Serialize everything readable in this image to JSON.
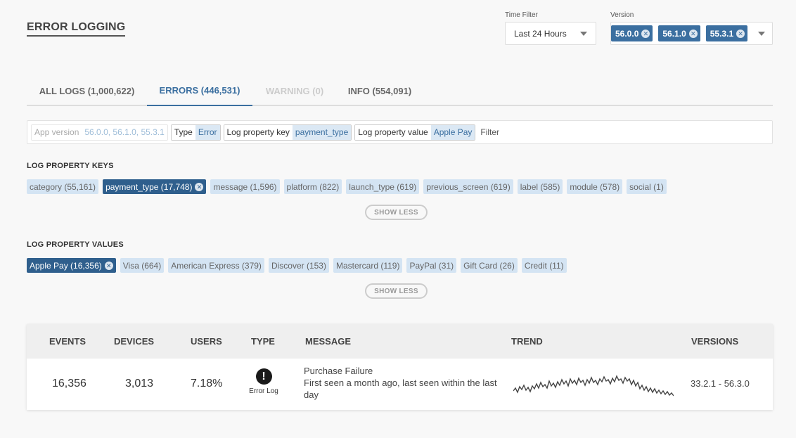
{
  "page_title": "ERROR LOGGING",
  "time_filter": {
    "label": "Time Filter",
    "value": "Last 24 Hours"
  },
  "version_filter": {
    "label": "Version",
    "selected": [
      "56.0.0",
      "56.1.0",
      "55.3.1"
    ]
  },
  "tabs": [
    {
      "label": "ALL LOGS (1,000,622)",
      "state": "normal"
    },
    {
      "label": "ERRORS (446,531)",
      "state": "active"
    },
    {
      "label": "WARNING (0)",
      "state": "disabled"
    },
    {
      "label": "INFO (554,091)",
      "state": "normal"
    }
  ],
  "query": {
    "tokens": [
      {
        "key": "App version",
        "value": "56.0.0, 56.1.0, 55.3.1",
        "faded": true
      },
      {
        "key": "Type",
        "value": "Error"
      },
      {
        "key": "Log property key",
        "value": "payment_type"
      },
      {
        "key": "Log property value",
        "value": "Apple Pay"
      }
    ],
    "placeholder": "Filter"
  },
  "property_keys": {
    "title": "LOG PROPERTY KEYS",
    "chips": [
      {
        "label": "category (55,161)"
      },
      {
        "label": "payment_type (17,748)",
        "selected": true
      },
      {
        "label": "message (1,596)"
      },
      {
        "label": "platform (822)"
      },
      {
        "label": "launch_type (619)"
      },
      {
        "label": "previous_screen (619)"
      },
      {
        "label": "label (585)"
      },
      {
        "label": "module (578)"
      },
      {
        "label": "social (1)"
      }
    ],
    "toggle": "SHOW LESS"
  },
  "property_values": {
    "title": "LOG PROPERTY VALUES",
    "chips": [
      {
        "label": "Apple Pay (16,356)",
        "selected": true
      },
      {
        "label": "Visa (664)"
      },
      {
        "label": "American Express (379)"
      },
      {
        "label": "Discover (153)"
      },
      {
        "label": "Mastercard (119)"
      },
      {
        "label": "PayPal (31)"
      },
      {
        "label": "Gift Card (26)"
      },
      {
        "label": "Credit (11)"
      }
    ],
    "toggle": "SHOW LESS"
  },
  "table": {
    "headers": {
      "events": "EVENTS",
      "devices": "DEVICES",
      "users": "USERS",
      "type": "TYPE",
      "message": "MESSAGE",
      "trend": "TREND",
      "versions": "VERSIONS"
    },
    "rows": [
      {
        "events": "16,356",
        "devices": "3,013",
        "users": "7.18%",
        "type_icon": "exclamation-circle-icon",
        "type": "Error Log",
        "message_title": "Purchase Failure",
        "message_detail": "First seen a month ago, last seen within the last day",
        "versions": "33.2.1 - 56.3.0"
      }
    ]
  },
  "colors": {
    "accent": "#3b6fa0",
    "chip": "#d4e4f3",
    "chip_selected": "#2f5f8d"
  }
}
